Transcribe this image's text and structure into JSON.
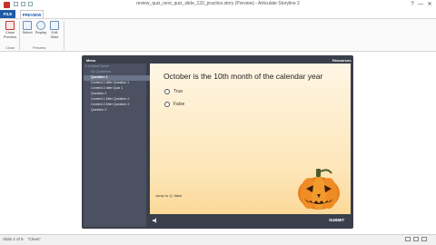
{
  "window": {
    "title": "review_quiz_next_quiz_slide_132_practice.story (Preview) - Articulate Storyline 2",
    "minimize": "—",
    "maximize": "☐",
    "close": "✕"
  },
  "ribbon": {
    "tabs": [
      "FILE",
      "PREVIEW"
    ],
    "buttons": {
      "close_preview": "Close Preview",
      "select": "Select",
      "replay": "Replay",
      "edit_slide": "Edit Slide"
    },
    "groups": {
      "close": "Close",
      "preview": "Preview"
    }
  },
  "player": {
    "menu_label": "Menu",
    "resources_label": "Resources",
    "menu_items": [
      {
        "label": "▾ Untitled Scene",
        "state": "dim"
      },
      {
        "label": "My Questions",
        "state": "dim"
      },
      {
        "label": "Question 1",
        "state": "selected"
      },
      {
        "label": "Content 1 after Question 1",
        "state": "normal"
      },
      {
        "label": "Content 2 after Quiz 1",
        "state": "normal"
      },
      {
        "label": "Question 2",
        "state": "normal"
      },
      {
        "label": "Content 1 After Question 2",
        "state": "normal"
      },
      {
        "label": "Content 2 After Question 2",
        "state": "normal"
      },
      {
        "label": "Question 3",
        "state": "normal"
      }
    ],
    "slide": {
      "question": "October is the 10th month of the calendar year",
      "options": [
        "True",
        "False"
      ],
      "jump_text": "Jump to Q: false"
    },
    "submit_label": "SUBMIT"
  },
  "status": {
    "slide_info": "Slide 2 of 9",
    "theme": "\"Clean\""
  },
  "colors": {
    "file_tab": "#1e5aa8",
    "player_frame": "#3a3f4b",
    "sidebar": "#4b5160",
    "slide_top": "#fff6e4",
    "slide_bottom": "#fbd999",
    "pumpkin": "#e8801f"
  }
}
